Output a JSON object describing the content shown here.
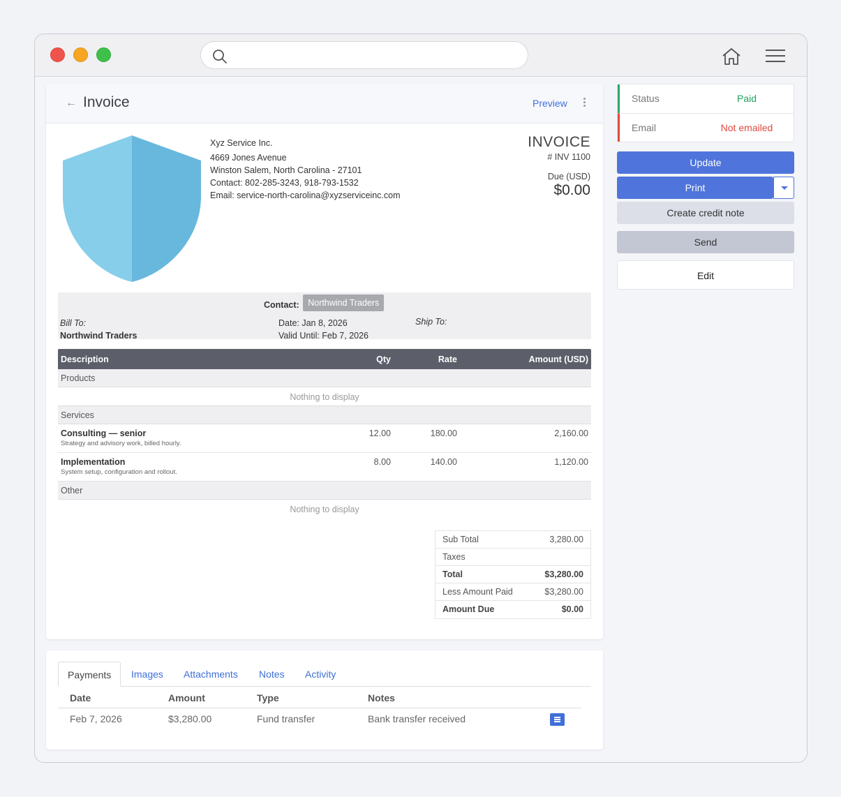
{
  "header": {
    "title": "Invoice",
    "preview_label": "Preview"
  },
  "company": {
    "name": "Xyz Service Inc.",
    "address": "4669 Jones Avenue",
    "city": "Winston Salem, North Carolina - 27101",
    "contact": "Contact: 802-285-3243, 918-793-1532",
    "email": "Email: service-north-carolina@xyzserviceinc.com"
  },
  "invoice": {
    "title": "INVOICE",
    "number": "# INV 1100",
    "due_label": "Due (USD)",
    "due_amount": "$0.00"
  },
  "info": {
    "contact_label": "Contact:",
    "contact_value": "Northwind Traders",
    "bill_to_label": "Bill To:",
    "bill_to_value": "Northwind Traders",
    "date": "Date:  Jan 8, 2026",
    "valid_until": "Valid Until:  Feb 7, 2026",
    "ship_to_label": "Ship To:"
  },
  "items": {
    "headers": {
      "description": "Description",
      "qty": "Qty",
      "rate": "Rate",
      "amount": "Amount (USD)"
    },
    "groups": {
      "products": "Products",
      "services": "Services",
      "other": "Other"
    },
    "empty_text": "Nothing to display",
    "rows": [
      {
        "name": "Consulting — senior",
        "desc": "Strategy and advisory work, billed hourly.",
        "qty": "12.00",
        "rate": "180.00",
        "amount": "2,160.00"
      },
      {
        "name": "Implementation",
        "desc": "System setup, configuration and rollout.",
        "qty": "8.00",
        "rate": "140.00",
        "amount": "1,120.00"
      }
    ]
  },
  "totals": {
    "subtotal_label": "Sub Total",
    "subtotal": "3,280.00",
    "taxes_label": "Taxes",
    "total_label": "Total",
    "total": "$3,280.00",
    "paid_label": "Less Amount Paid",
    "paid": "$3,280.00",
    "due_label": "Amount Due",
    "due": "$0.00"
  },
  "tabs": [
    "Payments",
    "Images",
    "Attachments",
    "Notes",
    "Activity"
  ],
  "payments": {
    "headers": {
      "date": "Date",
      "amount": "Amount",
      "type": "Type",
      "notes": "Notes"
    },
    "rows": [
      {
        "date": "Feb 7, 2026",
        "amount": "$3,280.00",
        "type": "Fund transfer",
        "notes": "Bank transfer received"
      }
    ]
  },
  "side": {
    "status_label": "Status",
    "status_value": "Paid",
    "email_label": "Email",
    "email_value": "Not emailed",
    "update_label": "Update",
    "print_label": "Print",
    "credit_label": "Create credit note",
    "send_label": "Send",
    "edit_label": "Edit"
  },
  "colors": {
    "accent": "#4f74db",
    "paid": "#22a05a",
    "not_emailed": "#e04a3f",
    "table_header": "#5c5e6a",
    "shield_light": "#87ceea",
    "shield_dark": "#68b8de"
  }
}
